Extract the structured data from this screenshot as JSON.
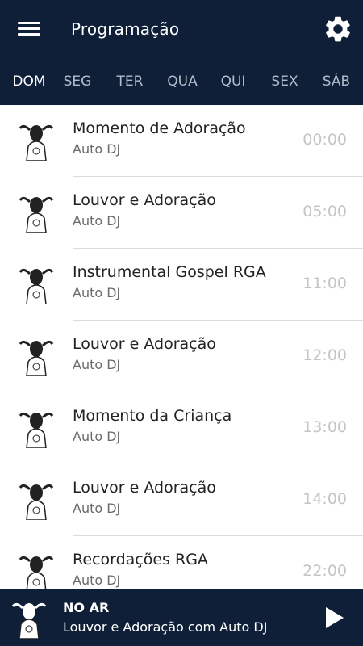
{
  "header": {
    "title": "Programação",
    "menu_icon": "hamburger-menu-icon",
    "settings_icon": "gear-icon",
    "background": "#0f1f38"
  },
  "days": {
    "items": [
      "DOM",
      "SEG",
      "TER",
      "QUA",
      "QUI",
      "SEX",
      "SÁB"
    ],
    "selected": "DOM"
  },
  "schedule": [
    {
      "name": "Momento de Adoração",
      "host": "Auto DJ",
      "time": "00:00"
    },
    {
      "name": "Louvor e Adoração",
      "host": "Auto DJ",
      "time": "05:00"
    },
    {
      "name": "Instrumental Gospel RGA",
      "host": "Auto DJ",
      "time": "11:00"
    },
    {
      "name": "Louvor e Adoração",
      "host": "Auto DJ",
      "time": "12:00"
    },
    {
      "name": "Momento da Criança",
      "host": "Auto DJ",
      "time": "13:00"
    },
    {
      "name": "Louvor e Adoração",
      "host": "Auto DJ",
      "time": "14:00"
    },
    {
      "name": "Recordações RGA",
      "host": "Auto DJ",
      "time": "22:00"
    }
  ],
  "player": {
    "status": "NO AR",
    "now_playing": "Louvor e Adoração com Auto DJ",
    "play_icon": "play-icon"
  }
}
